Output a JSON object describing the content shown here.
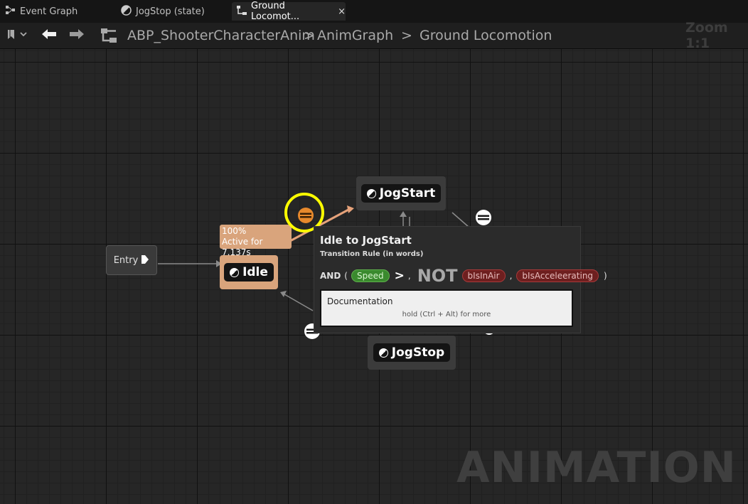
{
  "tabs": [
    {
      "label": "Event Graph",
      "icon": "event-graph-icon"
    },
    {
      "label": "JogStop (state)",
      "icon": "state-icon"
    },
    {
      "label": "Ground Locomot...",
      "icon": "state-machine-icon",
      "close": "×"
    }
  ],
  "toolbar": {
    "breadcrumbs": [
      "ABP_ShooterCharacterAnim",
      "AnimGraph",
      "Ground Locomotion"
    ],
    "separators": [
      ">",
      ">"
    ],
    "zoom": "Zoom 1:1"
  },
  "nodes": {
    "entry": "Entry",
    "idle": "Idle",
    "jogstart": "JogStart",
    "jogstop": "JogStop"
  },
  "idle_debug": {
    "weight": "100%",
    "active": "Active for 7.137s"
  },
  "tooltip": {
    "title": "Idle to JogStart",
    "subtitle": "Transition Rule (in words)",
    "rule": {
      "and": "AND",
      "open": "(",
      "speed": "Speed",
      "gt": ">",
      "comma1": ",",
      "not": "NOT",
      "binair": "bIsInAir",
      "comma2": ",",
      "baccel": "bIsAcceleerating",
      "close": ")"
    },
    "doc_title": "Documentation",
    "doc_hint": "hold (Ctrl + Alt) for more"
  },
  "watermark": "ANIMATION",
  "colors": {
    "active_node": "#d9a47c",
    "active_text": "#ffffff",
    "highlight_ring": "#ffff00",
    "active_transition": "#e8892c",
    "speed_pill": "#3a8a2e",
    "bool_pill": "#6e1f1f"
  }
}
